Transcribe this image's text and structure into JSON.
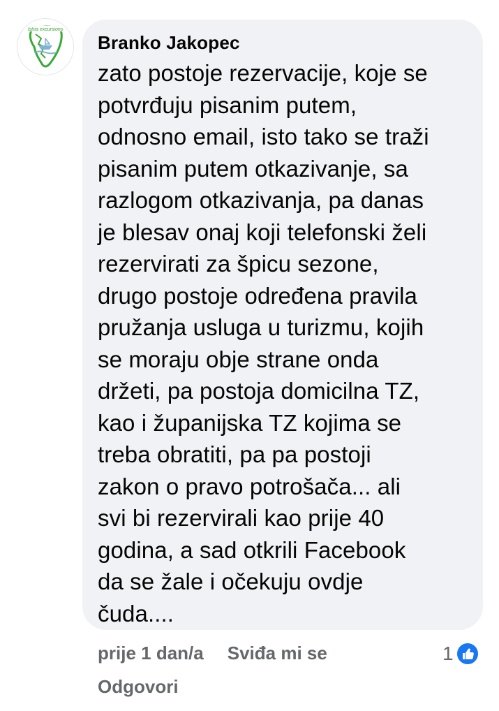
{
  "comment": {
    "author": "Branko Jakopec",
    "avatar_icon": "crtica-excursion-logo-icon",
    "text": "zato postoje rezervacije, koje se\npotvrđuju pisanim putem,\nodnosno email, isto tako se traži\npisanim putem otkazivanje, sa\nrazlogom otkazivanja, pa danas\nje blesav onaj koji telefonski želi\nrezervirati za špicu sezone,\ndrugo postoje određena pravila\npružanja usluga u turizmu, kojih\nse moraju obje strane onda\ndržeti, pa postoja domicilna TZ,\nkao i županijska TZ kojima se\ntreba obratiti, pa pa postoji\nzakon o pravo potrošača... ali\nsvi bi rezervirali kao prije 40\ngodina, a sad otkrili Facebook\nda se žale i očekuju ovdje\nčuda...."
  },
  "actions": {
    "time": "prije 1 dan/a",
    "like_label": "Sviđa mi se",
    "reply_label": "Odgovori"
  },
  "reactions": {
    "count": "1",
    "icon": "like-thumb-icon",
    "color": "#1877f2"
  },
  "colors": {
    "bubble_bg": "#f0f2f5",
    "text": "#050505",
    "secondary": "#65676b"
  }
}
